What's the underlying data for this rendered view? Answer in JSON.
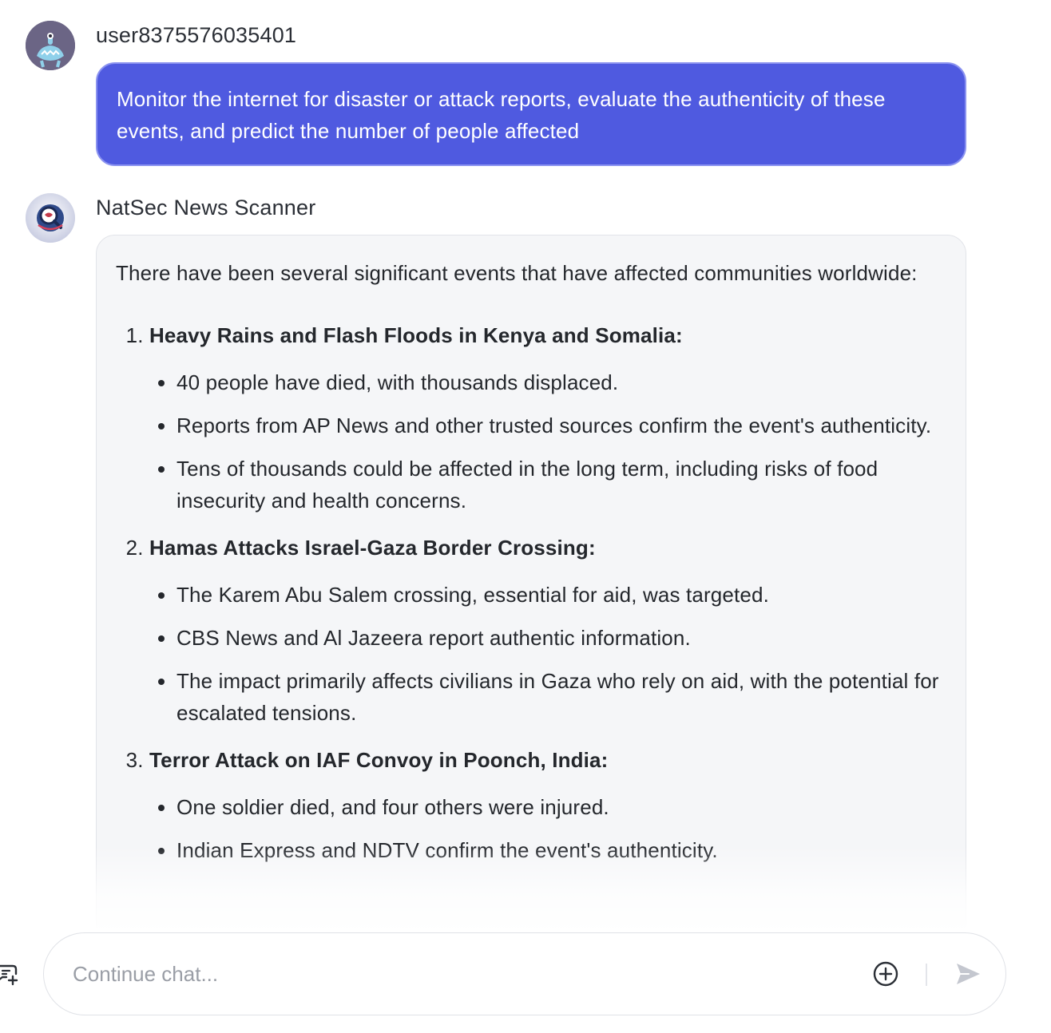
{
  "conversation": {
    "user_message": {
      "sender": "user8375576035401",
      "avatar_icon": "monster-avatar-icon",
      "text": "Monitor the internet for disaster or attack reports, evaluate the authenticity of these events, and predict the number of people affected"
    },
    "bot_message": {
      "sender": "NatSec News Scanner",
      "avatar_icon": "magnifier-globe-avatar-icon",
      "intro": "There have been several significant events that have affected communities worldwide:",
      "events": [
        {
          "title": "Heavy Rains and Flash Floods in Kenya and Somalia:",
          "points": [
            "40 people have died, with thousands displaced.",
            "Reports from AP News and other trusted sources confirm the event's authenticity.",
            "Tens of thousands could be affected in the long term, including risks of food insecurity and health concerns."
          ]
        },
        {
          "title": "Hamas Attacks Israel-Gaza Border Crossing:",
          "points": [
            "The Karem Abu Salem crossing, essential for aid, was targeted.",
            "CBS News and Al Jazeera report authentic information.",
            "The impact primarily affects civilians in Gaza who rely on aid, with the potential for escalated tensions."
          ]
        },
        {
          "title": "Terror Attack on IAF Convoy in Poonch, India:",
          "points": [
            "One soldier died, and four others were injured.",
            "Indian Express and NDTV confirm the event's authenticity."
          ]
        }
      ]
    }
  },
  "composer": {
    "placeholder": "Continue chat...",
    "value": "",
    "new_chat_icon": "new-chat-icon",
    "attach_icon": "plus-circle-icon",
    "send_icon": "send-icon"
  },
  "colors": {
    "user_bubble": "#4f5ae0",
    "bot_bubble": "#f5f6f8",
    "text": "#24272c",
    "placeholder": "#9a9ea6"
  }
}
